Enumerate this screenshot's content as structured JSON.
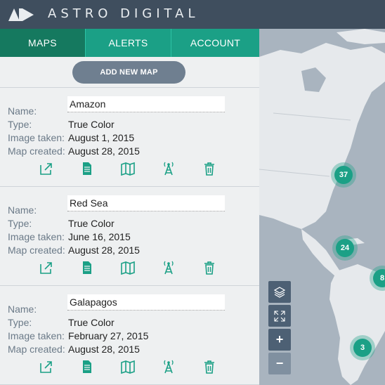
{
  "app": {
    "title": "ASTRO DIGITAL"
  },
  "tabs": [
    {
      "label": "MAPS",
      "active": true
    },
    {
      "label": "ALERTS",
      "active": false
    },
    {
      "label": "ACCOUNT",
      "active": false
    }
  ],
  "panel": {
    "add_button": "ADD NEW MAP"
  },
  "labels": {
    "name": "Name:",
    "type": "Type:",
    "image_taken": "Image taken:",
    "map_created": "Map created:"
  },
  "maps": [
    {
      "name": "Amazon",
      "type": "True Color",
      "image_taken": "August 1, 2015",
      "map_created": "August 28, 2015"
    },
    {
      "name": "Red Sea",
      "type": "True Color",
      "image_taken": "June 16, 2015",
      "map_created": "August 28, 2015"
    },
    {
      "name": "Galapagos",
      "type": "True Color",
      "image_taken": "February 27, 2015",
      "map_created": "August 28, 2015"
    }
  ],
  "card_actions": [
    "open-external-icon",
    "document-icon",
    "map-icon",
    "antenna-icon",
    "trash-icon"
  ],
  "map": {
    "clusters": [
      {
        "count": "37"
      },
      {
        "count": "24"
      },
      {
        "count": "8"
      },
      {
        "count": "3"
      }
    ],
    "controls": {
      "layers": "layers-icon",
      "fullscreen": "expand-icon",
      "zoom_in": "+",
      "zoom_out": "−"
    }
  },
  "colors": {
    "header": "#3f4e5e",
    "tab_active": "#15795f",
    "tab": "#1ba086",
    "accent": "#1ba086"
  }
}
